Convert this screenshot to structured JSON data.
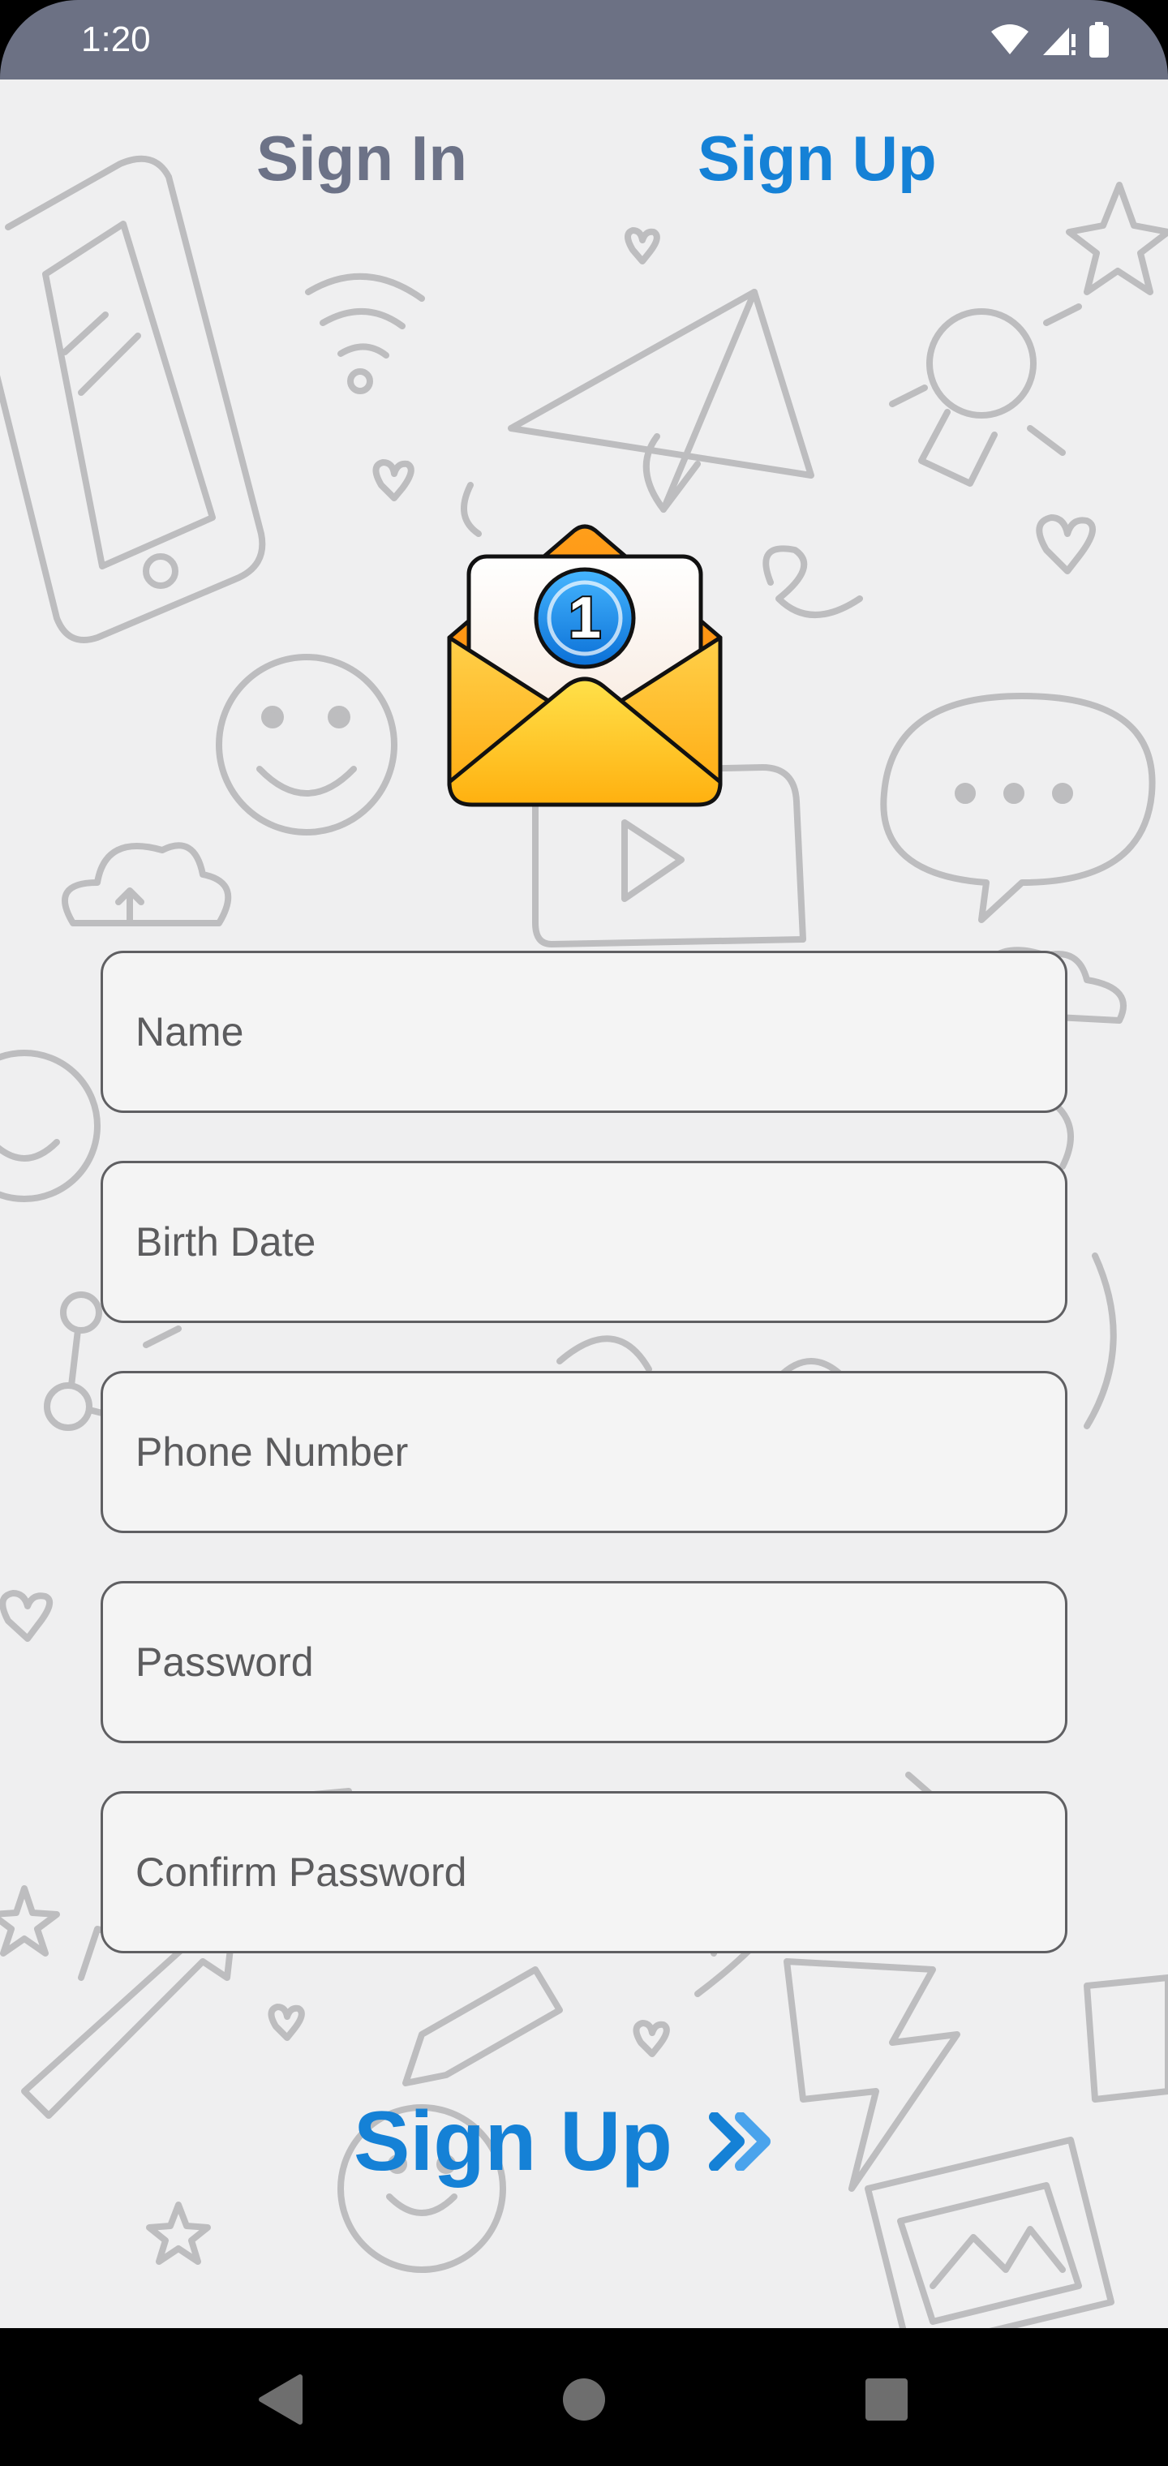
{
  "status_bar": {
    "time": "1:20",
    "icons": [
      "wifi-icon",
      "cellular-signal-icon",
      "battery-icon"
    ],
    "background": "#6c7184"
  },
  "tabs": [
    {
      "label": "Sign In",
      "active": false,
      "color": "#6c7287"
    },
    {
      "label": "Sign Up",
      "active": true,
      "color": "#1581d6"
    }
  ],
  "mail_icon": {
    "badge": "1"
  },
  "form": {
    "fields": [
      {
        "placeholder": "Name",
        "value": ""
      },
      {
        "placeholder": "Birth Date",
        "value": ""
      },
      {
        "placeholder": "Phone Number",
        "value": ""
      },
      {
        "placeholder": "Password",
        "value": ""
      },
      {
        "placeholder": "Confirm Password",
        "value": ""
      }
    ]
  },
  "submit": {
    "label": "Sign Up",
    "icon": "double-chevron-right-icon",
    "color": "#1581d6"
  },
  "nav_bar": {
    "buttons": [
      "back-icon",
      "home-icon",
      "recents-icon"
    ]
  }
}
